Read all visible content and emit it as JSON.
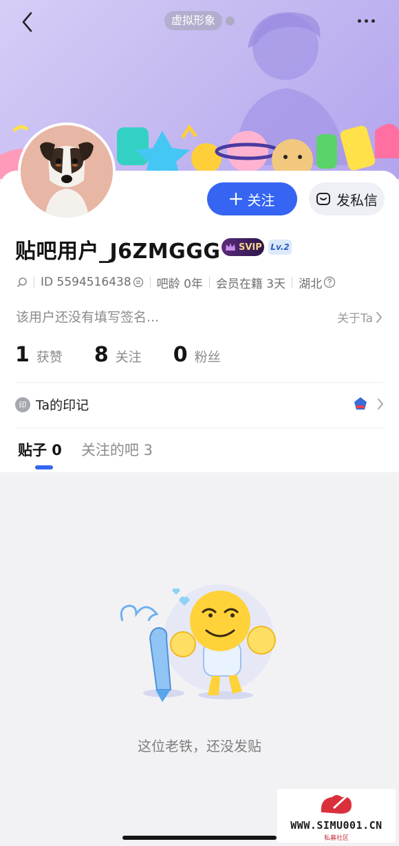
{
  "header": {
    "virtual_tag": "虚拟形象"
  },
  "profile": {
    "username": "贴吧用户_J6ZMGGG",
    "svip_label": "SVIP",
    "level_label": "Lv.2",
    "id_label": "ID 5594516438",
    "bar_age": "吧龄 0年",
    "member_days": "会员在籍 3天",
    "location": "湖北",
    "signature": "该用户还没有填写签名...",
    "about_label": "关于Ta"
  },
  "actions": {
    "follow_label": "关注",
    "dm_label": "发私信"
  },
  "stats": [
    {
      "value": "1",
      "label": "获赞"
    },
    {
      "value": "8",
      "label": "关注"
    },
    {
      "value": "0",
      "label": "粉丝"
    }
  ],
  "imprint": {
    "badge": "印",
    "label": "Ta的印记",
    "medal_num": "1"
  },
  "tabs": [
    {
      "label": "贴子 0"
    },
    {
      "label": "关注的吧 3"
    }
  ],
  "empty_state": {
    "text": "这位老铁，还没发贴"
  },
  "watermark": {
    "site": "WWW.SIMU001.CN",
    "sub": "私募社区"
  },
  "colors": {
    "accent": "#3565f2",
    "banner_start": "#d6cdf7",
    "banner_end": "#b3a4ee"
  }
}
